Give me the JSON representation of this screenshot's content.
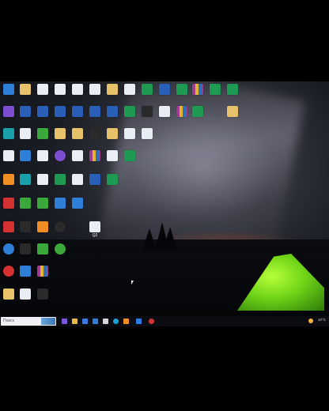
{
  "desktop": {
    "visible_label": "Q2"
  },
  "taskbar": {
    "search_text": "Поиск",
    "tray_temperature": "10°C"
  }
}
